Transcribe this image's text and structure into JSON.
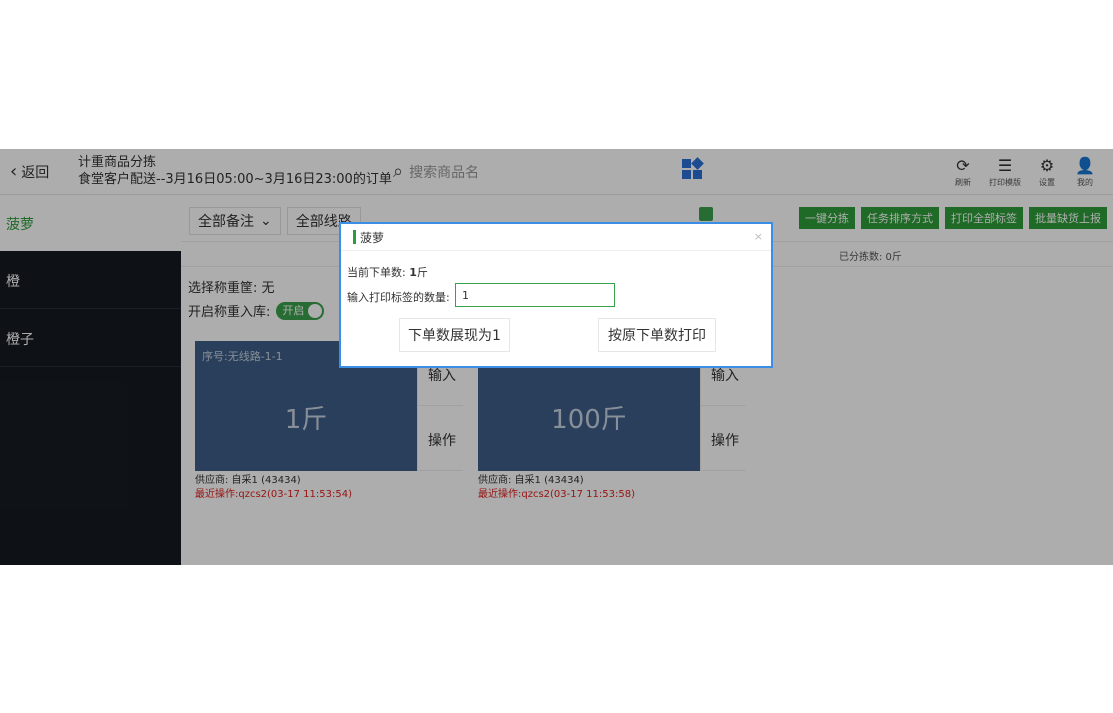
{
  "header": {
    "back_label": "返回",
    "title": "计重商品分拣",
    "subtitle": "食堂客户配送--3月16日05:00~3月16日23:00的订单",
    "search_placeholder": "搜索商品名",
    "tools": [
      {
        "icon": "refresh-icon",
        "glyph": "⟳",
        "label": "刷新"
      },
      {
        "icon": "print-template-icon",
        "glyph": "☰",
        "label": "打印模版"
      },
      {
        "icon": "gear-icon",
        "glyph": "⚙",
        "label": "设置"
      },
      {
        "icon": "user-icon",
        "glyph": "👤",
        "label": "我的"
      }
    ]
  },
  "sidebar": {
    "items": [
      {
        "label": "菠萝"
      },
      {
        "label": "橙"
      },
      {
        "label": "橙子"
      }
    ]
  },
  "main": {
    "filters": [
      "全部备注",
      "全部线路"
    ],
    "actions": [
      "一键分拣",
      "任务排序方式",
      "打印全部标签",
      "批量缺货上报"
    ],
    "stat": "已分拣数: 0斤",
    "basket_label": "选择称重筐:",
    "basket_value": "无",
    "inbound_label": "开启称重入库:",
    "toggle_label": "开启",
    "cards": [
      {
        "seq": "序号:无线路-1-1",
        "qty": "1斤",
        "input_label": "输入",
        "op_label": "操作",
        "supplier": "供应商: 自采1 (43434)",
        "last_op": "最近操作:qzcs2(03-17 11:53:54)"
      },
      {
        "seq": "",
        "qty": "100斤",
        "input_label": "输入",
        "op_label": "操作",
        "supplier": "供应商: 自采1 (43434)",
        "last_op": "最近操作:qzcs2(03-17 11:53:58)"
      }
    ]
  },
  "modal": {
    "title": "菠萝",
    "close": "×",
    "current_label": "当前下单数:",
    "current_value": "1",
    "current_unit": "斤",
    "input_label": "输入打印标签的数量:",
    "input_value": "1",
    "btn_show": "下单数展现为1",
    "btn_print": "按原下单数打印"
  },
  "colors": {
    "accent_green": "#2e9c3a",
    "card_blue": "#3d5d86",
    "modal_border": "#3a8ee6",
    "sidebar_dark": "#161b22",
    "warning_red": "#e02020"
  }
}
